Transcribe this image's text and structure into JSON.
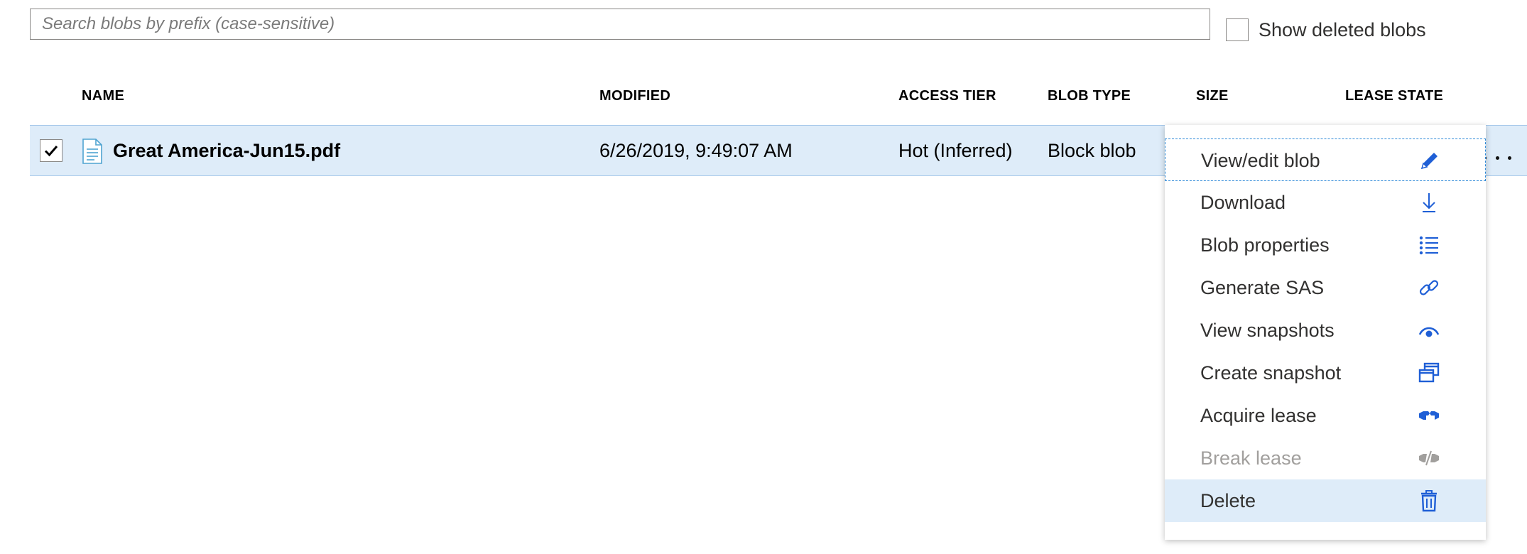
{
  "search": {
    "placeholder": "Search blobs by prefix (case-sensitive)",
    "value": ""
  },
  "show_deleted": {
    "label": "Show deleted blobs",
    "checked": false
  },
  "table": {
    "headers": {
      "name": "NAME",
      "modified": "MODIFIED",
      "access_tier": "ACCESS TIER",
      "blob_type": "BLOB TYPE",
      "size": "SIZE",
      "lease_state": "LEASE STATE"
    },
    "rows": [
      {
        "selected": true,
        "icon": "document-icon",
        "name": "Great America-Jun15.pdf",
        "modified": "6/26/2019, 9:49:07 AM",
        "access_tier": "Hot (Inferred)",
        "blob_type": "Block blob"
      }
    ]
  },
  "context_menu": {
    "items": [
      {
        "label": "View/edit blob",
        "icon": "pencil-icon",
        "disabled": false,
        "state": "focused"
      },
      {
        "label": "Download",
        "icon": "download-icon",
        "disabled": false,
        "state": ""
      },
      {
        "label": "Blob properties",
        "icon": "list-icon",
        "disabled": false,
        "state": ""
      },
      {
        "label": "Generate SAS",
        "icon": "link-icon",
        "disabled": false,
        "state": ""
      },
      {
        "label": "View snapshots",
        "icon": "eye-icon",
        "disabled": false,
        "state": ""
      },
      {
        "label": "Create snapshot",
        "icon": "copy-windows-icon",
        "disabled": false,
        "state": ""
      },
      {
        "label": "Acquire lease",
        "icon": "lease-icon",
        "disabled": false,
        "state": ""
      },
      {
        "label": "Break lease",
        "icon": "break-lease-icon",
        "disabled": true,
        "state": ""
      },
      {
        "label": "Delete",
        "icon": "trash-icon",
        "disabled": false,
        "state": "hovered"
      }
    ]
  },
  "colors": {
    "accent": "#0078d4",
    "selected_row": "#deecf9",
    "disabled": "#a19f9d"
  }
}
